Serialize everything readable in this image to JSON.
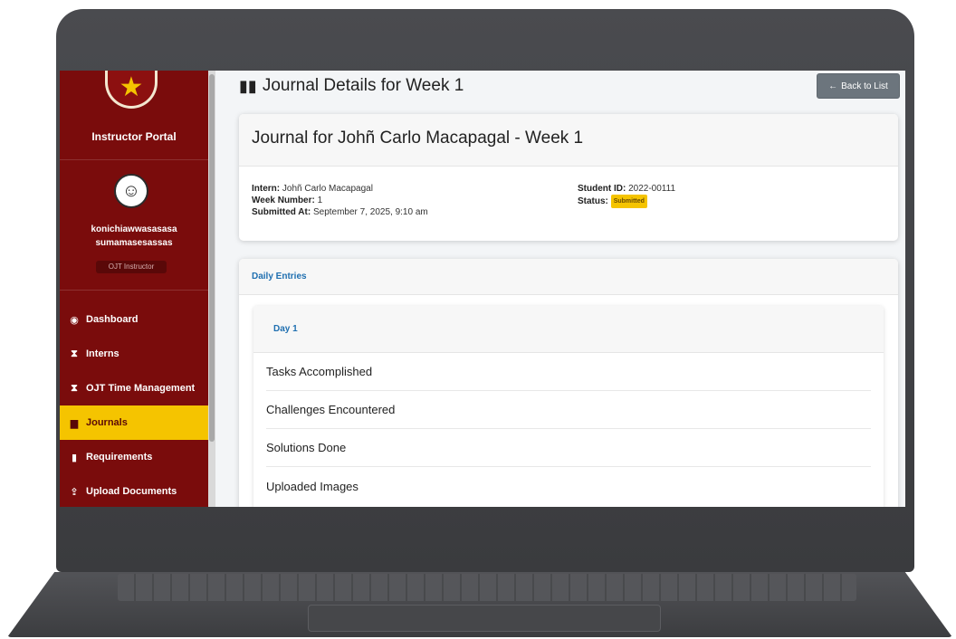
{
  "sidebar": {
    "portal_title": "Instructor Portal",
    "username": "konichiawwasasasa sumamasesassas",
    "role": "OJT Instructor",
    "items": [
      {
        "label": "Dashboard",
        "icon": "tachometer-icon"
      },
      {
        "label": "Interns",
        "icon": "hourglass-icon"
      },
      {
        "label": "OJT Time Management",
        "icon": "hourglass-icon"
      },
      {
        "label": "Journals",
        "icon": "book-icon",
        "active": true
      },
      {
        "label": "Requirements",
        "icon": "file-icon"
      },
      {
        "label": "Upload Documents",
        "icon": "upload-icon"
      }
    ]
  },
  "header": {
    "title": "Journal Details for Week 1",
    "back_label": "Back to List"
  },
  "journal": {
    "heading": "Journal for Johñ Carlo Macapagal - Week 1",
    "intern_label": "Intern:",
    "intern": "Johñ Carlo Macapagal",
    "week_label": "Week Number:",
    "week": "1",
    "submitted_label": "Submitted At:",
    "submitted": "September 7, 2025, 9:10 am",
    "student_id_label": "Student ID:",
    "student_id": "2022-00111",
    "status_label": "Status:",
    "status": "Submitted"
  },
  "daily": {
    "heading": "Daily Entries",
    "day_label": "Day 1",
    "sections": [
      "Tasks Accomplished",
      "Challenges Encountered",
      "Solutions Done",
      "Uploaded Images"
    ]
  },
  "colors": {
    "sidebar": "#7a0c0c",
    "active_item": "#f5c400",
    "accent_link": "#1f6fb0",
    "back_button": "#6c757d"
  }
}
